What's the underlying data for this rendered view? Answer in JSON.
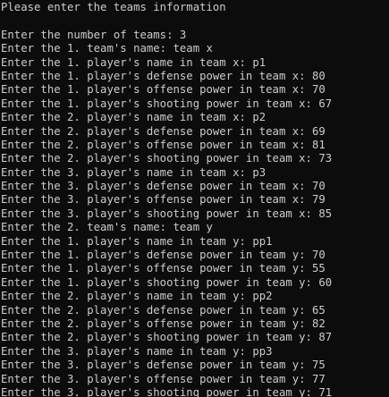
{
  "console": {
    "background": "#0c0c0c",
    "foreground": "#cccccc",
    "lines": [
      "Please enter the teams information",
      "",
      "Enter the number of teams: 3",
      "Enter the 1. team's name: team x",
      "Enter the 1. player's name in team x: p1",
      "Enter the 1. player's defense power in team x: 80",
      "Enter the 1. player's offense power in team x: 70",
      "Enter the 1. player's shooting power in team x: 67",
      "Enter the 2. player's name in team x: p2",
      "Enter the 2. player's defense power in team x: 69",
      "Enter the 2. player's offense power in team x: 81",
      "Enter the 2. player's shooting power in team x: 73",
      "Enter the 3. player's name in team x: p3",
      "Enter the 3. player's defense power in team x: 70",
      "Enter the 3. player's offense power in team x: 79",
      "Enter the 3. player's shooting power in team x: 85",
      "Enter the 2. team's name: team y",
      "Enter the 1. player's name in team y: pp1",
      "Enter the 1. player's defense power in team y: 70",
      "Enter the 1. player's offense power in team y: 55",
      "Enter the 1. player's shooting power in team y: 60",
      "Enter the 2. player's name in team y: pp2",
      "Enter the 2. player's defense power in team y: 65",
      "Enter the 2. player's offense power in team y: 82",
      "Enter the 2. player's shooting power in team y: 87",
      "Enter the 3. player's name in team y: pp3",
      "Enter the 3. player's defense power in team y: 75",
      "Enter the 3. player's offense power in team y: 77",
      "Enter the 3. player's shooting power in team y: 71"
    ]
  }
}
